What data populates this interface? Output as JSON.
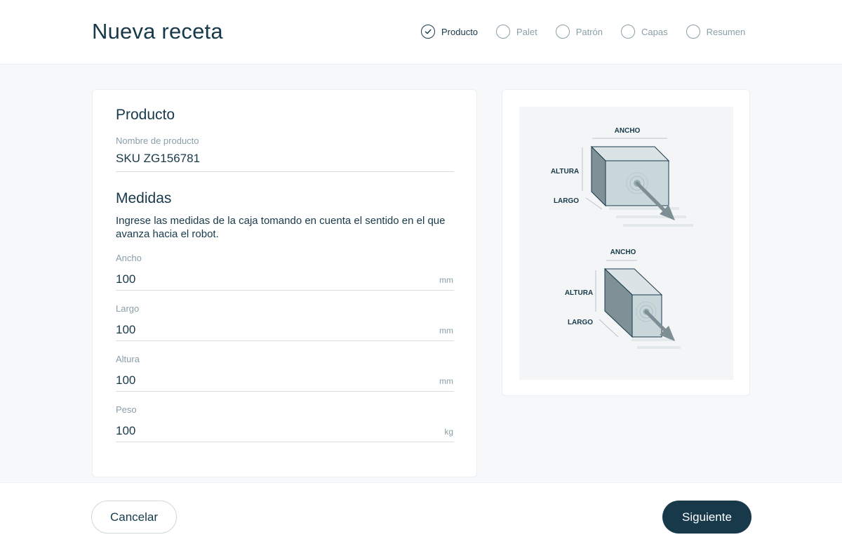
{
  "header": {
    "title": "Nueva receta"
  },
  "steps": [
    {
      "label": "Producto",
      "status": "completed"
    },
    {
      "label": "Palet",
      "status": "pending"
    },
    {
      "label": "Patrón",
      "status": "pending"
    },
    {
      "label": "Capas",
      "status": "pending"
    },
    {
      "label": "Resumen",
      "status": "pending"
    }
  ],
  "producto": {
    "heading": "Producto",
    "name_label": "Nombre de producto",
    "name_value": "SKU ZG156781"
  },
  "medidas": {
    "heading": "Medidas",
    "description": "Ingrese las medidas de la caja tomando en cuenta el sentido en el que avanza hacia el robot.",
    "fields": [
      {
        "label": "Ancho",
        "value": "100",
        "unit": "mm"
      },
      {
        "label": "Largo",
        "value": "100",
        "unit": "mm"
      },
      {
        "label": "Altura",
        "value": "100",
        "unit": "mm"
      },
      {
        "label": "Peso",
        "value": "100",
        "unit": "kg"
      }
    ]
  },
  "illustration": {
    "top": {
      "ancho": "ANCHO",
      "altura": "ALTURA",
      "largo": "LARGO"
    },
    "bottom": {
      "ancho": "ANCHO",
      "altura": "ALTURA",
      "largo": "LARGO"
    }
  },
  "footer": {
    "cancel_label": "Cancelar",
    "next_label": "Siguiente"
  },
  "colors": {
    "primary": "#17394a",
    "muted": "#8a9ea7",
    "background": "#f6f8f9"
  }
}
